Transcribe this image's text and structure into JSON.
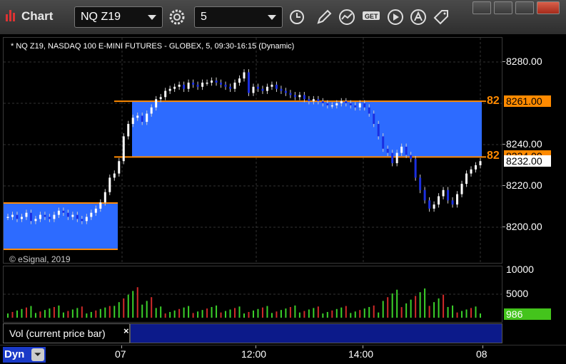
{
  "window": {
    "title": "Chart",
    "symbol": "NQ Z19",
    "interval": "5"
  },
  "toolbar": {
    "icons": [
      "gear-icon",
      "clock-icon",
      "pencil-icon",
      "line-study-icon",
      "get-icon",
      "play-icon",
      "alert-icon",
      "tag-icon"
    ]
  },
  "chart": {
    "info": "* NQ Z19, NASDAQ 100 E-MINI FUTURES - GLOBEX, 5, 09:30-16:15 (Dynamic)",
    "copyright": "© eSignal, 2019",
    "price_ticks": [
      "8280.00",
      "8261.00",
      "8240.00",
      "8220.00",
      "8200.00"
    ],
    "level_labels": [
      "82",
      "82"
    ],
    "badges": {
      "upper": "8261.00",
      "mid": "8234.00",
      "last": "8232.00"
    },
    "colors": {
      "zone": "#2d6bff",
      "level": "#ff8a00",
      "up": "#ffffff",
      "down": "#1b2fe0"
    }
  },
  "chart_data": {
    "type": "bar",
    "title": "",
    "price_axis_ticks": [
      8280,
      8260,
      8240,
      8220,
      8200
    ],
    "horizontal_levels": [
      8261,
      8234
    ],
    "last_price": 8232,
    "volume_axis_ticks": [
      10000,
      5000,
      0
    ],
    "last_volume": 986,
    "time_labels": [
      "07",
      "12:00",
      "14:00",
      "08"
    ]
  },
  "volume": {
    "ticks": [
      "10000",
      "5000",
      "0"
    ],
    "last": "986",
    "study_label": "Vol (current price bar)",
    "close_symbol": "×"
  },
  "time_axis": {
    "labels": [
      "07",
      "12:00",
      "14:00",
      "08"
    ],
    "dyn_label": "Dyn"
  }
}
